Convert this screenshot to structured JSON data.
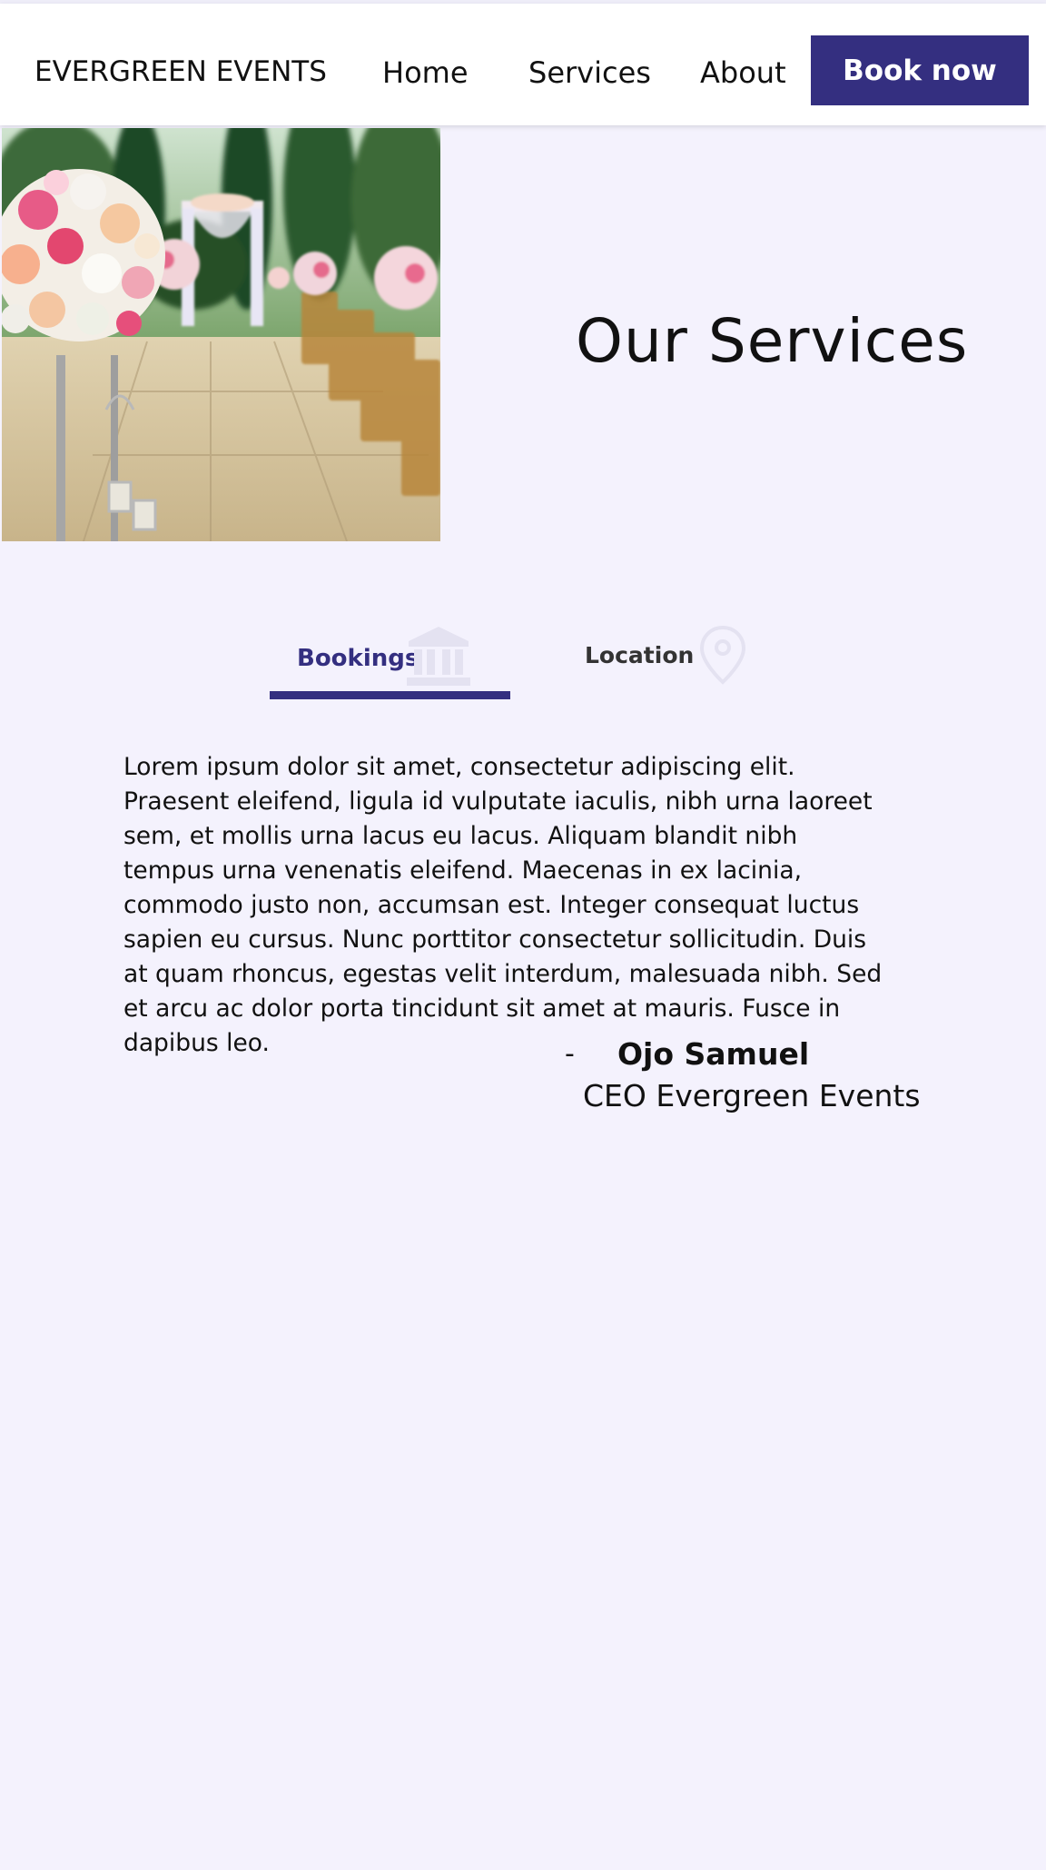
{
  "header": {
    "logo": "EVERGREEN EVENTS",
    "nav": {
      "home": "Home",
      "services": "Services",
      "about": "About"
    },
    "book_now": "Book now"
  },
  "hero": {
    "title": "Our Services"
  },
  "tabs": {
    "bookings": "Bookings",
    "location": "Location"
  },
  "content": {
    "paragraph": "Lorem ipsum dolor sit amet, consectetur adipiscing elit. Praesent eleifend, ligula id vulputate iaculis, nibh urna laoreet sem, et mollis urna lacus eu lacus. Aliquam blandit nibh tempus urna venenatis eleifend. Maecenas in ex lacinia, commodo justo non, accumsan est. Integer consequat luctus sapien eu cursus. Nunc porttitor consectetur sollicitudin. Duis at quam rhoncus, egestas velit interdum, malesuada nibh. Sed et arcu ac dolor porta tincidunt sit amet at mauris. Fusce in dapibus leo.",
    "signature": {
      "dash": "-",
      "name": "Ojo Samuel",
      "role": "CEO Evergreen Events"
    }
  },
  "colors": {
    "accent": "#342f80",
    "background": "#f4f2fd",
    "icon_muted": "#e4e2f1"
  },
  "icons": {
    "bookings_tab": "bank-building-icon",
    "location_tab": "map-pin-icon"
  }
}
